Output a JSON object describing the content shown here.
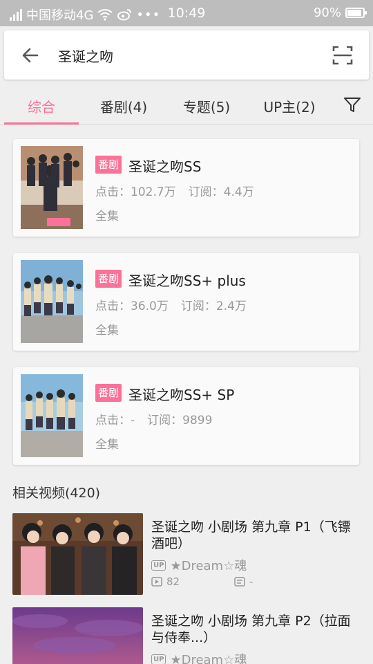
{
  "status_bar": {
    "carrier": "中国移动4G",
    "time": "10:49",
    "battery": "90%",
    "battery_level": 0.9
  },
  "search": {
    "query": "圣诞之吻"
  },
  "tabs": [
    {
      "label": "综合",
      "active": true
    },
    {
      "label": "番剧(4)",
      "active": false
    },
    {
      "label": "专题(5)",
      "active": false
    },
    {
      "label": "UP主(2)",
      "active": false
    }
  ],
  "bangumi": [
    {
      "badge": "番剧",
      "title": "圣诞之吻SS",
      "clicks": "点击：102.7万",
      "subs": "订阅：4.4万",
      "episodes": "全集"
    },
    {
      "badge": "番剧",
      "title": "圣诞之吻SS+ plus",
      "clicks": "点击：36.0万",
      "subs": "订阅：2.4万",
      "episodes": "全集"
    },
    {
      "badge": "番剧",
      "title": "圣诞之吻SS+ SP",
      "clicks": "点击：-",
      "subs": "订阅：9899",
      "episodes": "全集"
    }
  ],
  "related": {
    "header": "相关视频(420)",
    "videos": [
      {
        "title": "圣诞之吻 小剧场 第九章 P1（飞镖酒吧）",
        "up_tag": "UP",
        "uploader": "★Dream☆魂",
        "plays": "82",
        "danmaku": "-"
      },
      {
        "title": "圣诞之吻 小剧场 第九章 P2（拉面与侍奉...）",
        "up_tag": "UP",
        "uploader": "★Dream☆魂",
        "plays": "",
        "danmaku": ""
      }
    ]
  },
  "colors": {
    "accent": "#fb7299",
    "status_bar": "#bdbdbd",
    "background": "#efefef"
  }
}
